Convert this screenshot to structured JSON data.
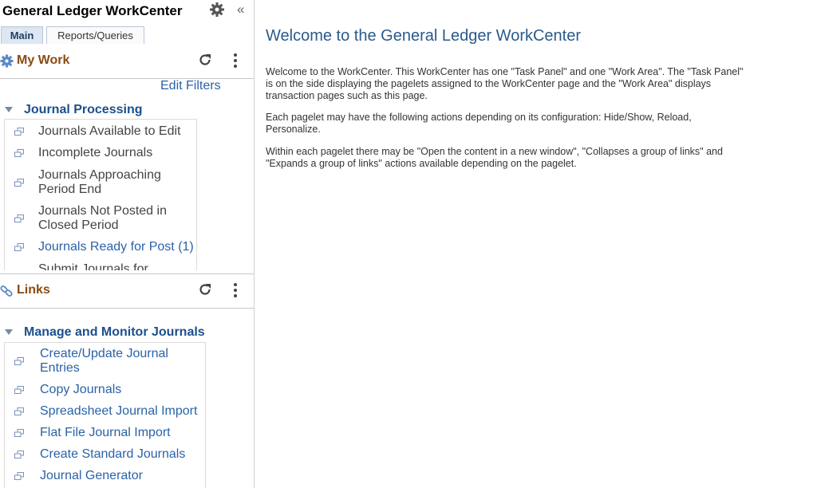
{
  "panel": {
    "title": "General Ledger WorkCenter",
    "tabs": [
      "Main",
      "Reports/Queries"
    ]
  },
  "my_work": {
    "title": "My Work",
    "edit_filters": "Edit Filters",
    "group": "Journal Processing",
    "items": [
      {
        "label": "Journals Available to Edit"
      },
      {
        "label": "Incomplete Journals"
      },
      {
        "label": "Journals Approaching Period End"
      },
      {
        "label": "Journals Not Posted in Closed Period"
      },
      {
        "label": "Journals Ready for Post (1)"
      },
      {
        "label": "Submit Journals for"
      }
    ]
  },
  "links": {
    "title": "Links",
    "group": "Manage and Monitor Journals",
    "items": [
      {
        "label": "Create/Update Journal Entries"
      },
      {
        "label": "Copy Journals"
      },
      {
        "label": "Spreadsheet Journal Import"
      },
      {
        "label": "Flat File Journal Import"
      },
      {
        "label": "Create Standard Journals"
      },
      {
        "label": "Journal Generator"
      }
    ]
  },
  "work_area": {
    "heading": "Welcome to the General Ledger WorkCenter",
    "paragraphs": [
      "Welcome to the WorkCenter. This WorkCenter has one \"Task Panel\" and one \"Work Area\". The \"Task Panel\" is on the side displaying the pagelets assigned to the WorkCenter page and the \"Work Area\" displays transaction pages such as this page.",
      "Each pagelet may have the following actions depending on its configuration: Hide/Show, Reload, Personalize.",
      "Within each pagelet there may be \"Open the content in a new window\", \"Collapses a group of links\" and \"Expands a group of links\" actions available depending on the pagelet."
    ]
  },
  "colors": {
    "pagelet_title": "#8a4b12",
    "group_title": "#1c4f8c",
    "link": "#2a62a8",
    "heading": "#2a5a8c"
  },
  "icons": [
    "settings-gear-icon",
    "collapse-panel-icon",
    "my-work-gear-icon",
    "refresh-icon",
    "more-actions-icon",
    "link-chain-icon",
    "collapse-triangle-icon",
    "link-window-icon"
  ]
}
